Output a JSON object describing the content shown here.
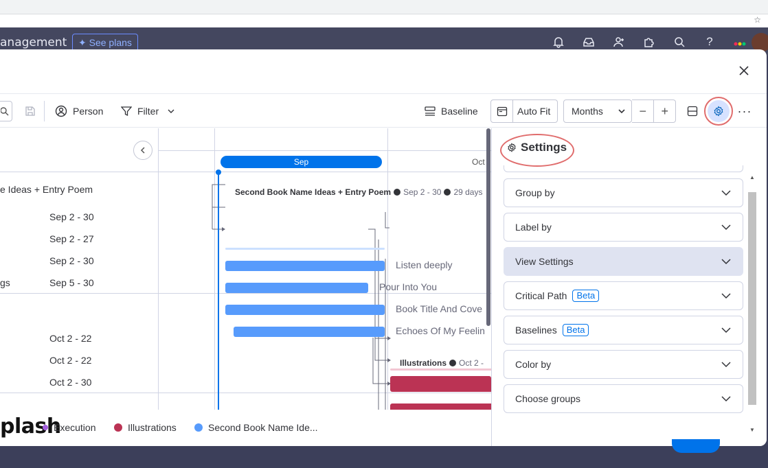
{
  "top_bar": {
    "brand_text": "anagement",
    "see_plans": "See plans"
  },
  "toolbar": {
    "person": "Person",
    "filter": "Filter",
    "baseline": "Baseline",
    "auto_fit": "Auto Fit",
    "months": "Months",
    "zoom_out": "−",
    "zoom_in": "+",
    "more": "···"
  },
  "left_rows": [
    {
      "name": "e Ideas + Entry Poem",
      "date": ""
    },
    {
      "name": "",
      "date": "Sep 2 - 30"
    },
    {
      "name": "",
      "date": "Sep 2 - 27"
    },
    {
      "name": "",
      "date": "Sep 2 - 30"
    },
    {
      "name": "gs",
      "date": "Sep 5 - 30"
    },
    {
      "name": "",
      "date": "Oct 2 - 22"
    },
    {
      "name": "",
      "date": "Oct 2 - 22"
    },
    {
      "name": "",
      "date": "Oct 2 - 30"
    }
  ],
  "timeline": {
    "month_sep": "Sep",
    "month_oct": "Oct",
    "group1": {
      "title": "Second Book Name Ideas + Entry Poem",
      "range": "Sep 2 - 30",
      "duration": "29 days",
      "color": "#579bfc"
    },
    "group2": {
      "title": "Illustrations",
      "range": "Oct 2 -",
      "color": "#bb3354"
    },
    "items": [
      {
        "label": "Listen deeply",
        "start": "Sep 2",
        "end": "Sep 30"
      },
      {
        "label": "Pour Into You",
        "start": "Sep 2",
        "end": "Sep 27"
      },
      {
        "label": "Book Title And Cove",
        "start": "Sep 2",
        "end": "Sep 30"
      },
      {
        "label": "Echoes Of My Feelin",
        "start": "Sep 5",
        "end": "Sep 30"
      }
    ]
  },
  "legend": {
    "watermark": "plash",
    "items": [
      {
        "label": "Execution",
        "color": "#a25ddc"
      },
      {
        "label": "Illustrations",
        "color": "#bb3354"
      },
      {
        "label": "Second Book Name Ide...",
        "color": "#579bfc"
      }
    ]
  },
  "settings": {
    "title": "Settings",
    "sections": [
      {
        "label": "Group by",
        "beta": ""
      },
      {
        "label": "Label by",
        "beta": ""
      },
      {
        "label": "View Settings",
        "beta": ""
      },
      {
        "label": "Critical Path",
        "beta": "Beta"
      },
      {
        "label": "Baselines",
        "beta": "Beta"
      },
      {
        "label": "Color by",
        "beta": ""
      },
      {
        "label": "Choose groups",
        "beta": ""
      }
    ]
  }
}
